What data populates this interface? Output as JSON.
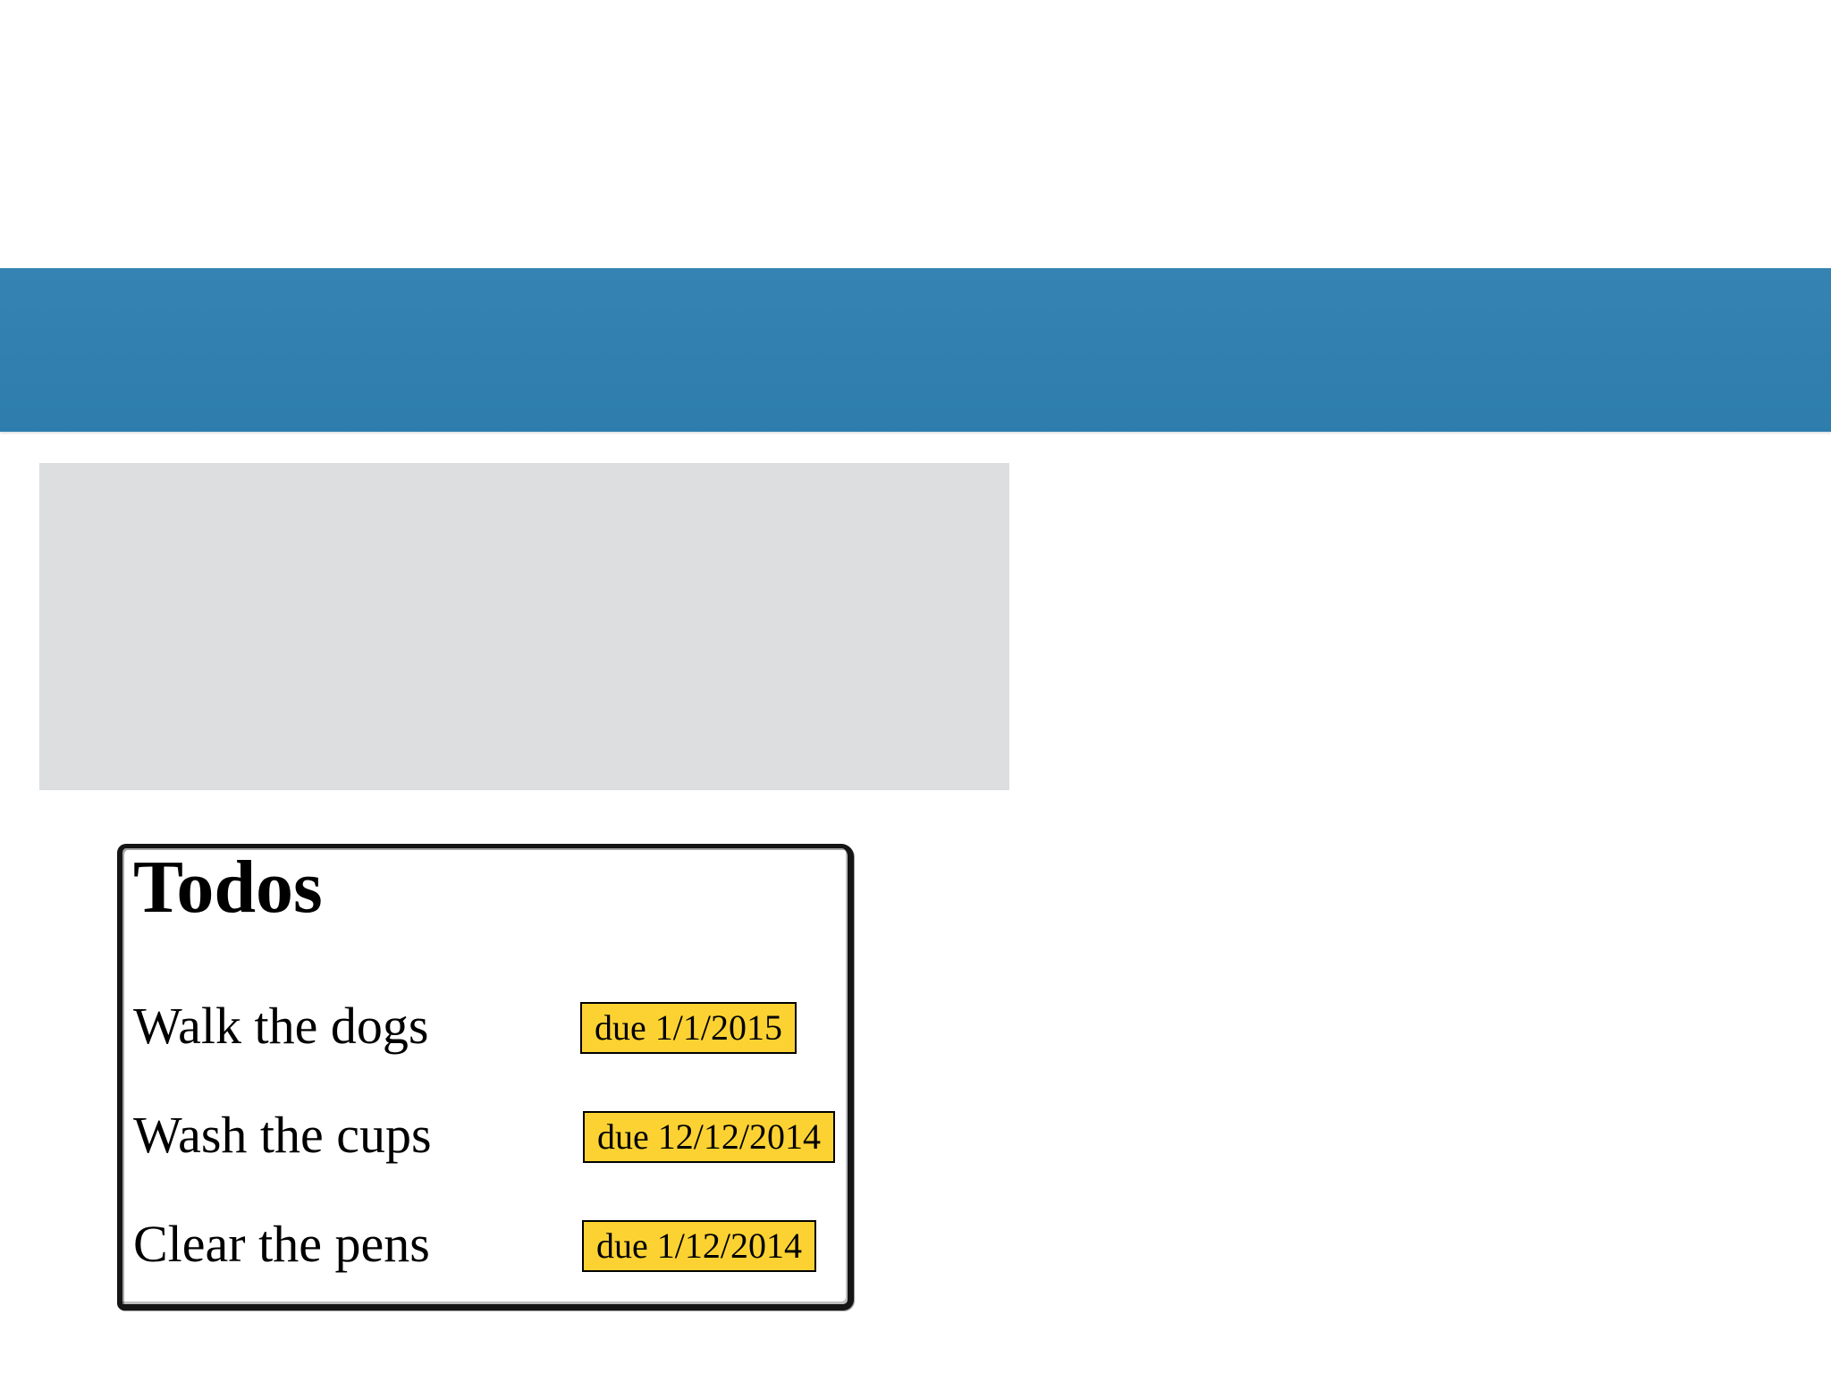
{
  "colors": {
    "banner": "#2e7fb0",
    "placeholder": "#dddee0",
    "badge": "#fcd232",
    "border": "#151515"
  },
  "todos": {
    "title": "Todos",
    "items": [
      {
        "label": "Walk the dogs",
        "due": "due 1/1/2015"
      },
      {
        "label": "Wash the cups",
        "due": "due 12/12/2014"
      },
      {
        "label": "Clear the pens",
        "due": "due 1/12/2014"
      }
    ]
  }
}
